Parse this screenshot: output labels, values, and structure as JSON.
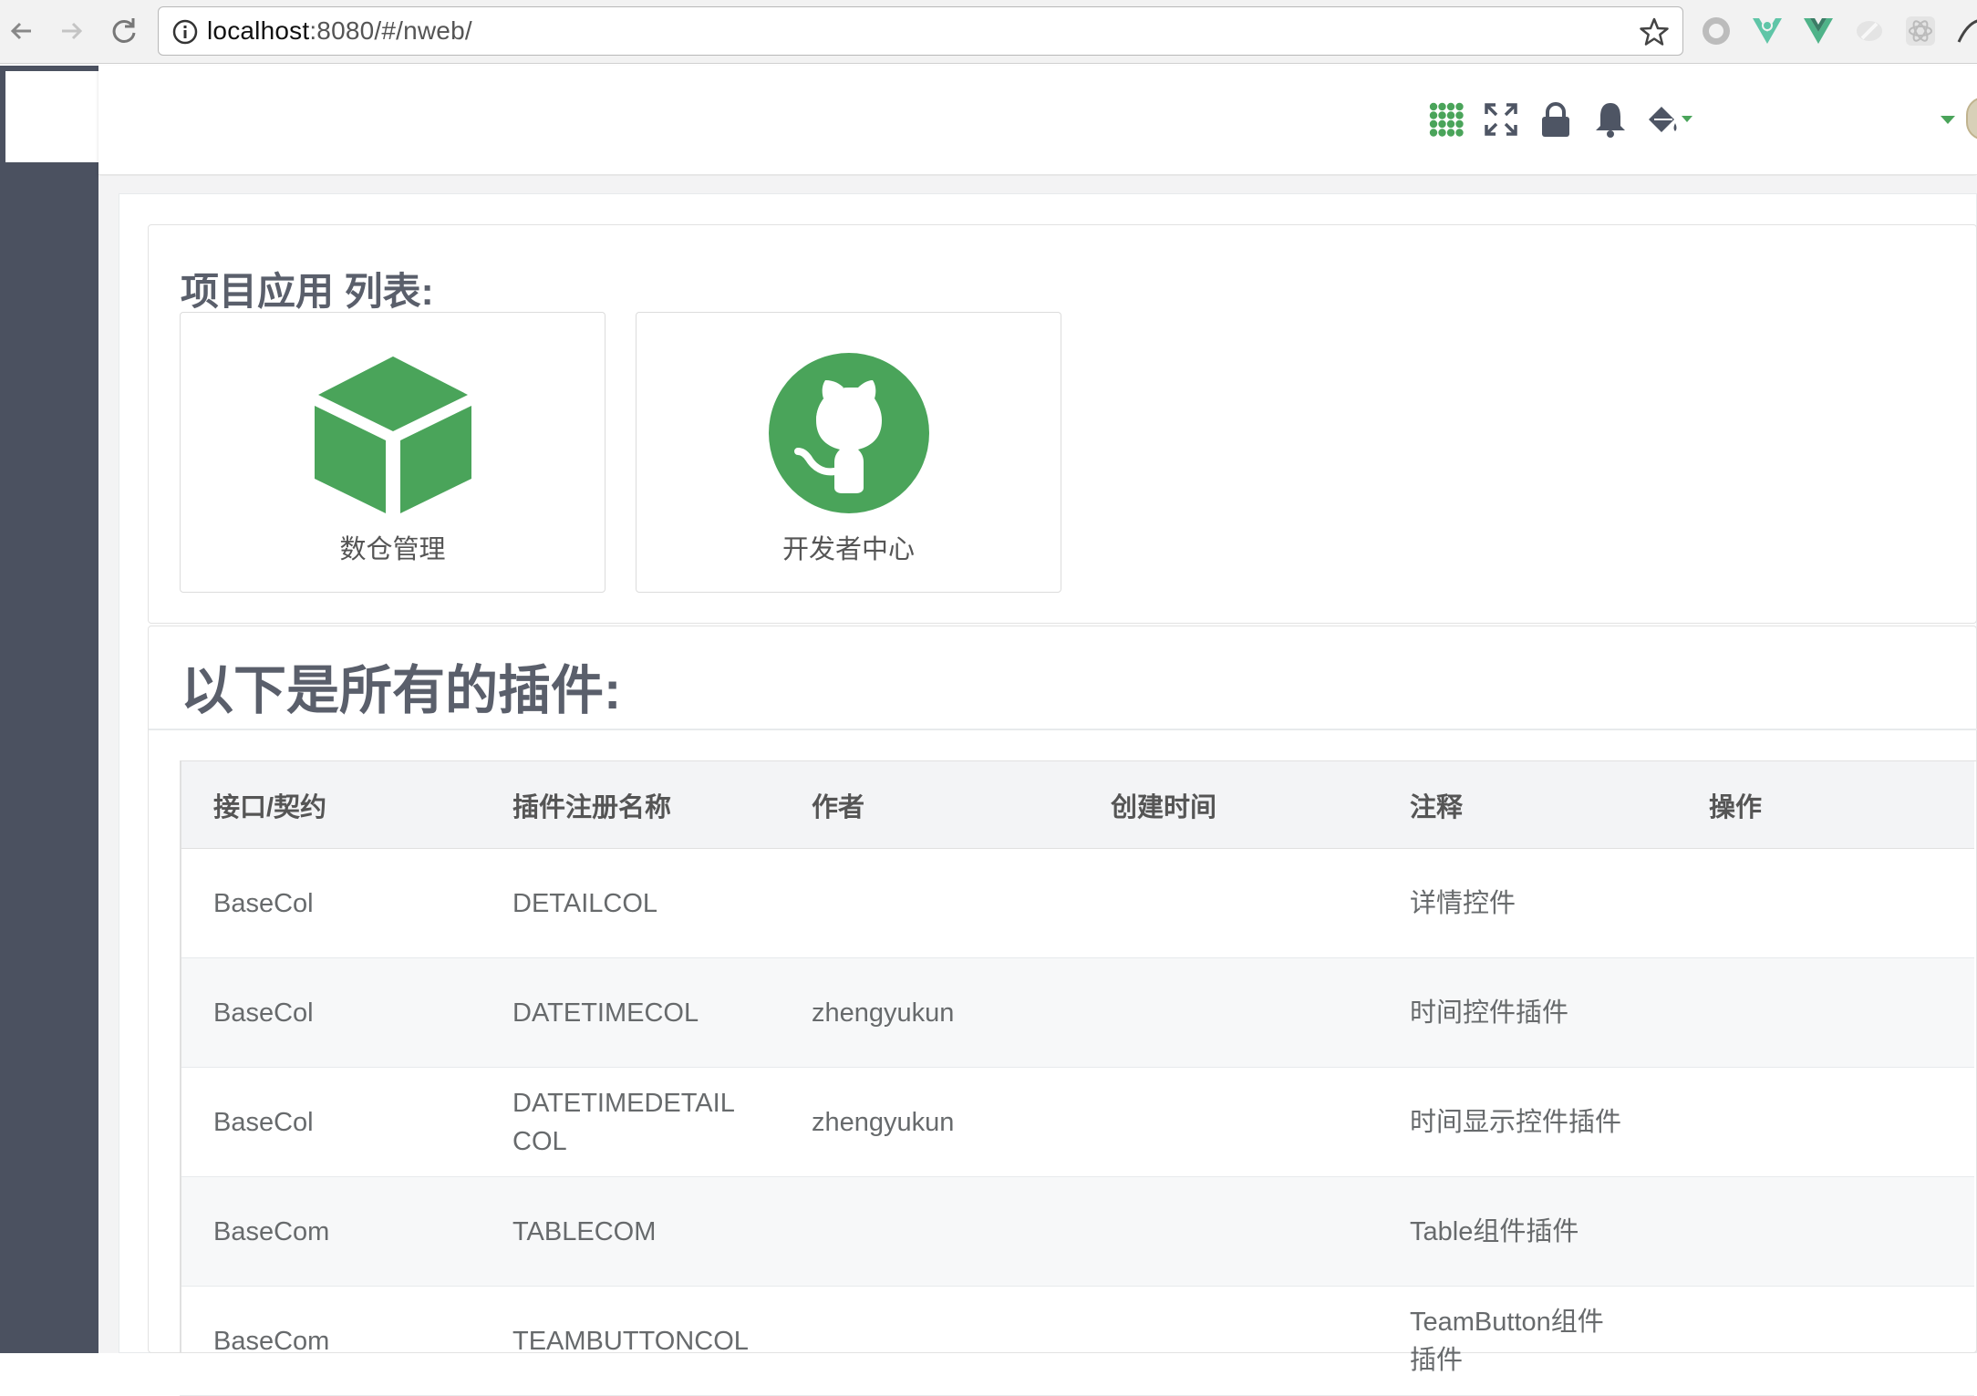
{
  "browser": {
    "url_host": "localhost",
    "url_rest": ":8080/#/nweb/"
  },
  "icons": {
    "back": "arrow-left-icon",
    "forward": "arrow-right-icon",
    "reload": "reload-icon",
    "info": "info-icon",
    "star": "star-icon",
    "topbar": [
      "grid-icon",
      "fullscreen-icon",
      "lock-icon",
      "bell-icon",
      "paint-bucket-icon",
      "caret-down-icon"
    ]
  },
  "colors": {
    "accent": "#4aa45a",
    "sidebar": "#4b5160"
  },
  "apps_section": {
    "title": "项目应用 列表:",
    "apps": [
      {
        "label": "数仓管理",
        "icon": "cube-icon"
      },
      {
        "label": "开发者中心",
        "icon": "github-icon"
      }
    ]
  },
  "plugins_section": {
    "title": "以下是所有的插件:",
    "columns": [
      "接口/契约",
      "插件注册名称",
      "作者",
      "创建时间",
      "注释",
      "操作"
    ],
    "rows": [
      {
        "contract": "BaseCol",
        "name": "DETAILCOL",
        "author": "",
        "created": "",
        "comment": "详情控件",
        "action": ""
      },
      {
        "contract": "BaseCol",
        "name": "DATETIMECOL",
        "author": "zhengyukun",
        "created": "",
        "comment": "时间控件插件",
        "action": ""
      },
      {
        "contract": "BaseCol",
        "name": "DATETIMEDETAILCOL",
        "author": "zhengyukun",
        "created": "",
        "comment": "时间显示控件插件",
        "action": ""
      },
      {
        "contract": "BaseCom",
        "name": "TABLECOM",
        "author": "",
        "created": "",
        "comment": "Table组件插件",
        "action": ""
      },
      {
        "contract": "BaseCom",
        "name": "TEAMBUTTONCOL",
        "author": "",
        "created": "",
        "comment": "TeamButton组件插件",
        "action": ""
      }
    ]
  }
}
